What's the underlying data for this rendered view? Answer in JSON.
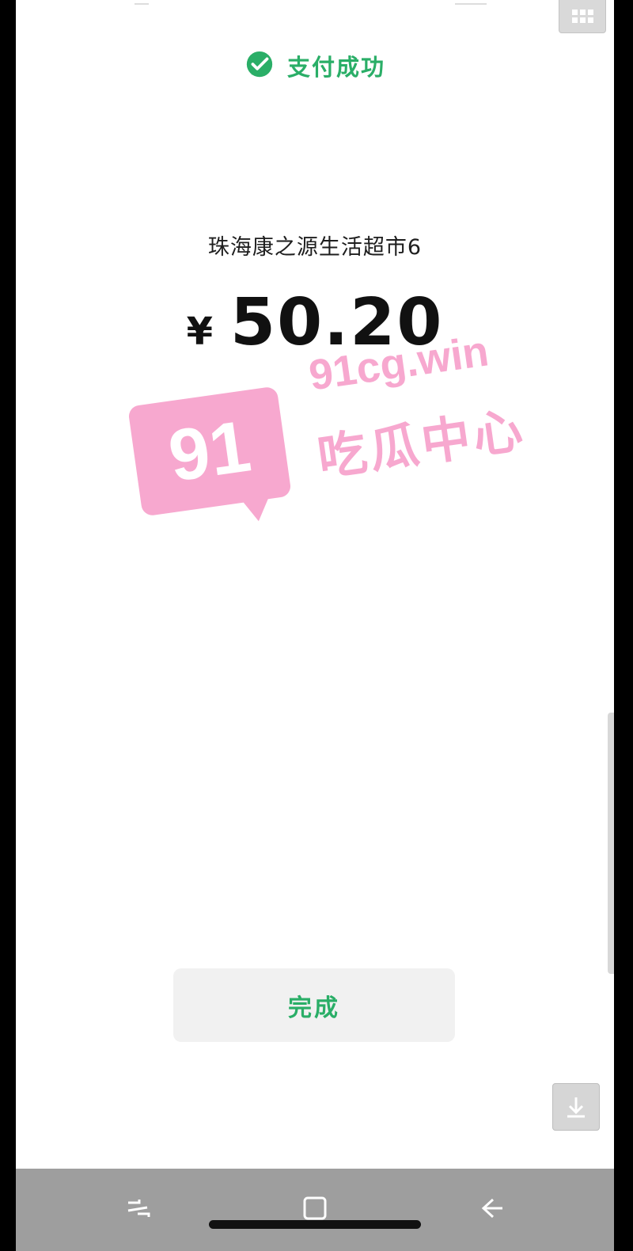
{
  "payment_status": {
    "label": "支付成功",
    "icon": "wechat-pay-icon",
    "color": "#2aae67"
  },
  "merchant": {
    "name": "珠海康之源生活超市6"
  },
  "amount": {
    "currency_symbol": "¥",
    "value": "50.20"
  },
  "actions": {
    "done_label": "完成",
    "download_icon": "download-icon",
    "grid_icon": "keyboard-grid-icon"
  },
  "watermark": {
    "badge": "91",
    "site": "91cg.win",
    "slogan": "吃瓜中心",
    "color": "#f7a8cf"
  },
  "navbar": {
    "recent_icon": "recent-apps-icon",
    "home_icon": "home-icon",
    "back_icon": "back-icon"
  }
}
